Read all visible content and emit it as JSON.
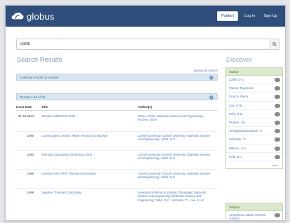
{
  "header": {
    "logo_text": "globus",
    "publish_label": "Publish",
    "login_label": "Log In",
    "signup_label": "Sign Up",
    "bg_color": "#2f4e7c"
  },
  "search": {
    "value": "cahill",
    "icon": "search-icon"
  },
  "results": {
    "title": "Search Results",
    "advanced_search": "advanced search",
    "collection_results": "Collection results (2 results)",
    "results_range": "Results 1-10 of 59",
    "columns": [
      "Issue Date",
      "Title",
      "Author(s)"
    ],
    "rows": [
      {
        "date": "31-Jul-2014",
        "title": "Sample Cahill Demo Data",
        "author": "NCSA; NCSA; Materials Science and Engineering; Rastner, Jason"
      },
      {
        "date": "1990",
        "title": "Corning glass ceramic #9606 Thermal Conductivity",
        "author": "Cornell University; Cornell University; Materials Science and Engineering; Cahill, D.G."
      },
      {
        "date": "1990",
        "title": "Thermal Conductivity Amorphous SiO2",
        "author": "Cornell University; Cornell University; Materials Science and Engineering; Cahill, D.G."
      },
      {
        "date": "1990",
        "title": "Corning Pyrex 9740 Thermal Conductivity",
        "author": "Cornell University; Cornell University; Materials Science and Engineering; Cahill, D.G."
      },
      {
        "date": "1998",
        "title": "Sapphire Thermal Conductivity",
        "author": "University of Illinois at Urbana-Champaign; Materials Science and Engineering; Materials Science and Engineering; Cahill, D.G.; Sebhater, T.I.; Lee, S.-M."
      }
    ]
  },
  "discover": {
    "title": "Discover",
    "author_facet": {
      "label": "Author",
      "items": [
        "Cahill, D.G.",
        "Flamer, Raymond",
        "Ficarra, Mario",
        "Lee, S.-M.",
        "Pohl, R.O.",
        "Prupne, Jim",
        "Venkatasubramanian, R.",
        "Sebhater, T.I.",
        "Watson, S.K.",
        "Rahl, B.J."
      ],
      "more": "next >"
    },
    "subject_facet": {
      "label": "Subject",
      "items": [
        "Amorphous solids, thermal conduct..."
      ]
    }
  }
}
